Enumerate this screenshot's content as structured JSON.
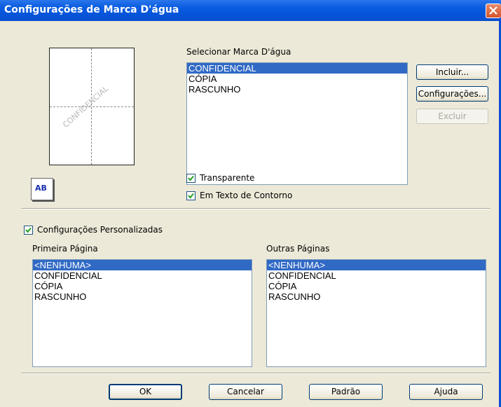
{
  "window": {
    "title": "Configurações de Marca D'água"
  },
  "preview": {
    "watermark_text": "CONFIDENCIAL",
    "ab_icon_text": "AB"
  },
  "select_watermark": {
    "label": "Selecionar Marca D'água",
    "items": [
      "CONFIDENCIAL",
      "CÓPIA",
      "RASCUNHO"
    ],
    "selected": "CONFIDENCIAL"
  },
  "buttons": {
    "add": "Incluir...",
    "settings": "Configurações...",
    "delete": "Excluir",
    "ok": "OK",
    "cancel": "Cancelar",
    "default": "Padrão",
    "help": "Ajuda"
  },
  "options": {
    "transparent": {
      "label": "Transparente",
      "checked": true
    },
    "outline": {
      "label": "Em Texto de Contorno",
      "checked": true
    },
    "custom": {
      "label": "Configurações Personalizadas",
      "checked": true
    }
  },
  "first_page": {
    "label": "Primeira Página",
    "items": [
      "<NENHUMA>",
      "CONFIDENCIAL",
      "CÓPIA",
      "RASCUNHO"
    ],
    "selected": "<NENHUMA>"
  },
  "other_pages": {
    "label": "Outras Páginas",
    "items": [
      "<NENHUMA>",
      "CONFIDENCIAL",
      "CÓPIA",
      "RASCUNHO"
    ],
    "selected": "<NENHUMA>"
  }
}
